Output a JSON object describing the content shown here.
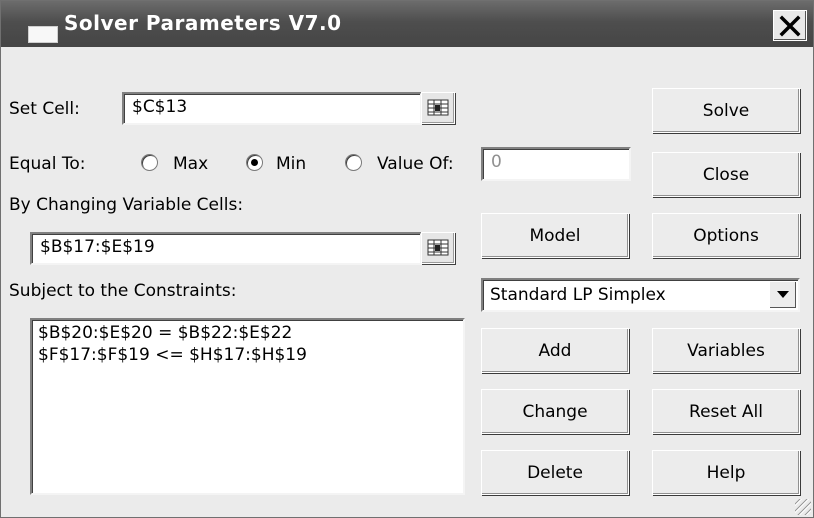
{
  "window": {
    "title": "Solver Parameters V7.0"
  },
  "set_cell": {
    "label": "Set Cell:",
    "value": "$C$13"
  },
  "equal_to": {
    "label": "Equal To:",
    "options": [
      "Max",
      "Min",
      "Value Of:"
    ],
    "selected": "Min",
    "value_of": "0"
  },
  "changing_cells": {
    "label": "By Changing Variable Cells:",
    "value": "$B$17:$E$19"
  },
  "constraints": {
    "label": "Subject to the Constraints:",
    "items": [
      "$B$20:$E$20 = $B$22:$E$22",
      "$F$17:$F$19 <= $H$17:$H$19"
    ]
  },
  "engine": {
    "selected": "Standard LP Simplex"
  },
  "buttons": {
    "solve": "Solve",
    "close": "Close",
    "model": "Model",
    "options": "Options",
    "add": "Add",
    "variables": "Variables",
    "change": "Change",
    "reset_all": "Reset All",
    "delete": "Delete",
    "help": "Help"
  },
  "icons": {
    "close": "close-icon",
    "range_picker": "range-picker-icon",
    "dropdown": "chevron-down-icon"
  }
}
